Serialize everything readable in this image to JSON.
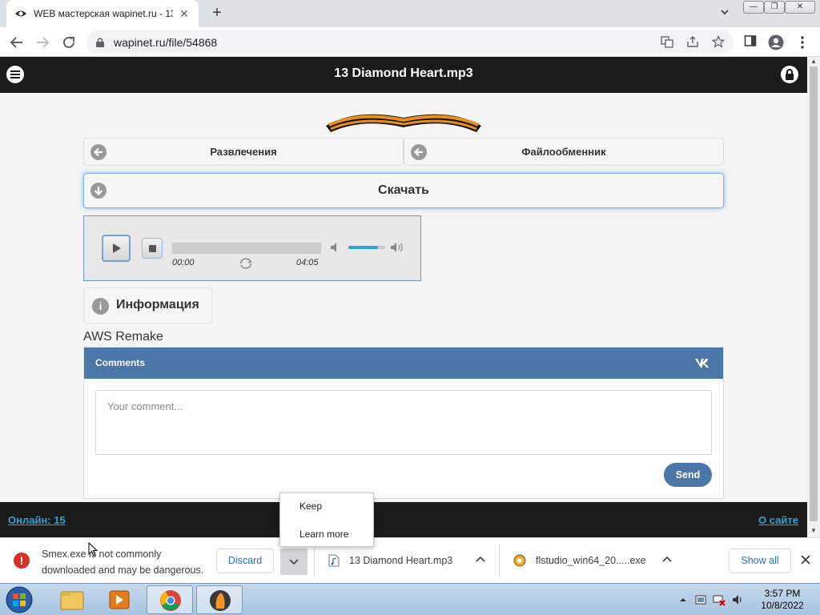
{
  "browser": {
    "tab_title": "WEB мастерская wapinet.ru - 13",
    "new_tab": "+",
    "url": "wapinet.ru/file/54868"
  },
  "site": {
    "title": "13 Diamond Heart.mp3",
    "nav": [
      {
        "label": "Развлечения"
      },
      {
        "label": "Файлообменник"
      }
    ],
    "download_label": "Скачать",
    "player": {
      "time_current": "00:00",
      "time_total": "04:05",
      "volume_level": 0.8
    },
    "info_label": "Информация",
    "description": "AWS Remake",
    "comments": {
      "title": "Comments",
      "brand": "VK",
      "placeholder": "Your comment...",
      "send_label": "Send"
    },
    "footer": {
      "online_label": "Онлайн: 15",
      "about_label": "О сайте"
    }
  },
  "context_menu": {
    "items": [
      "Keep",
      "Learn more"
    ]
  },
  "download_bar": {
    "warning_text": "Smex.exe is not commonly downloaded and may be dangerous.",
    "discard_label": "Discard",
    "items": [
      {
        "name": "13 Diamond Heart.mp3"
      },
      {
        "name": "flstudio_win64_20.....exe"
      }
    ],
    "show_all_label": "Show all"
  },
  "taskbar": {
    "time": "3:57 PM",
    "date": "10/8/2022"
  },
  "colors": {
    "vk_blue": "#4a76a8",
    "link_blue": "#2aa4d6",
    "header_dark": "#1b1b1b",
    "warning_red": "#d93025"
  }
}
